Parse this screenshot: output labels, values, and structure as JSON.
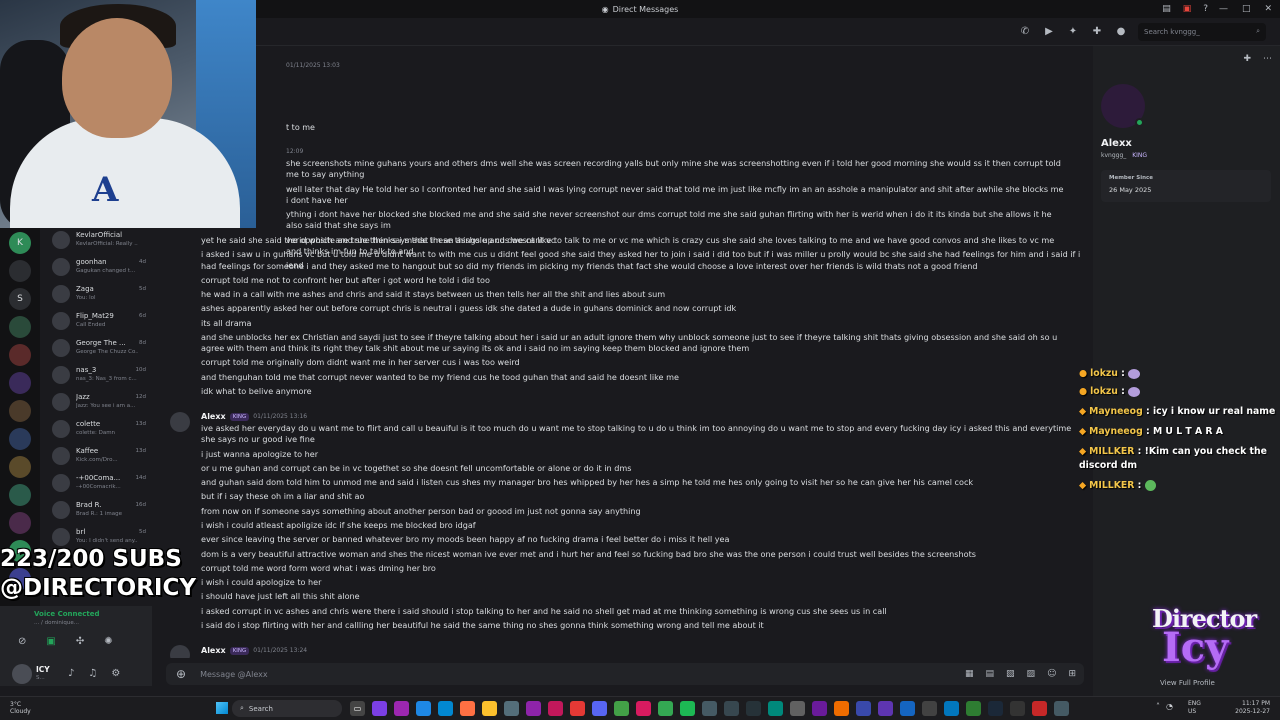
{
  "window": {
    "title": "Direct Messages"
  },
  "header": {
    "search_placeholder": "Search kvnggg_"
  },
  "dm_list": [
    {
      "name": "KevlarOfficial",
      "sub": "KevlarOfficial: Really ...",
      "time": ""
    },
    {
      "name": "goonhan",
      "sub": "Gagukan changed t...",
      "time": "4d"
    },
    {
      "name": "Zaga",
      "sub": "You: lol",
      "time": "5d"
    },
    {
      "name": "Flip_Mat29",
      "sub": "Call Ended",
      "time": "6d"
    },
    {
      "name": "George The ...",
      "sub": "George The Chuzz Co...",
      "time": "8d"
    },
    {
      "name": "nas_3",
      "sub": "nas_3: Nas_3 from c...",
      "time": "10d"
    },
    {
      "name": "Jazz",
      "sub": "Jazz: You see i am a...",
      "time": "12d"
    },
    {
      "name": "colette",
      "sub": "colette: Damn",
      "time": "13d"
    },
    {
      "name": "Kaffee",
      "sub": "Kick.com/Dro...",
      "time": "13d"
    },
    {
      "name": "-+00Coma...",
      "sub": "-+00Comacrik...",
      "time": "14d"
    },
    {
      "name": "Brad R.",
      "sub": "Brad R.: 1 image",
      "time": "16d"
    },
    {
      "name": "brl",
      "sub": "You: I didn't send any...",
      "time": "5d"
    }
  ],
  "messages": {
    "top_ts": "01/11/2025 13:03",
    "top_frag1": "t to me",
    "top_ts2": "12:09",
    "block1": [
      "she screenshots mine guhans yours and others dms well she was screen recording yalls but only mine she was screenshotting even if i told her good morning she would ss it then corrupt told me to say anything",
      "well later that day He told her so I confronted her and she said I was lying corrupt never said that told me im just like mcfly im an an asshole a manipulator and shit after awhile she blocks me i dont have her",
      "ything i dont have her blocked she blocked me and she said she never screenshot our dms corrupt told me she said guhan flirting with her is werid when i do it its kinda but she allows it he also said that she says im",
      "verid which are true then says that im an asshole and doesnt like to talk to me or vc me which is crazy cus she said she loves talking to me and we have good convos and she likes to vc me and thinks im fun to talk to and",
      "iend"
    ],
    "block2": [
      "yet he said she said the opposite and she thinks i made these things up cus we cant vc",
      "i asked i saw u in guhans vc but u told me u didnt want to with me cus u didnt feel good she said they asked her to join i said i did too but if i was miller u prolly would bc she said she had feelings for him and i said if i had feelings for someone i and they asked me to hangout but so did my friends im picking my friends that fact she would choose a love interest over her friends is wild thats not a good friend",
      "corrupt told me not to confront her but after i got word he told i did too",
      "he wad in a call with me ashes and chris and said it stays between us then tells her all the shit and lies about sum",
      "ashes apparently asked her out before corrupt chris is neutral i guess idk she dated a dude in guhans dominick and now corrupt idk",
      "its all drama",
      "and she unblocks her ex Christian and saydi just to see if theyre talking about her i said ur an adult ignore them why unblock someone just to see if theyre talking shit thats giving obsession and she said oh so u agree with them and think its right they talk shit about me ur saying its ok and i said no im saying keep them blocked and ignore them",
      "corrupt told me originally dom didnt want me in her server cus i was too weird",
      "and thenguhan told me that corrupt never wanted to be my friend cus he tood guhan that and said he doesnt like me",
      "idk what to belive anymore"
    ],
    "author1": "Alexx",
    "badge": "KING",
    "ts1": "01/11/2025 13:16",
    "block3": [
      "ive asked her everyday do u want me to flirt and call u beauiful is it too much do u want me to stop talking to u do u think im too annoying do u want me to stop and every fucking day icy i asked this and everytime she says no ur good ive fine",
      "i just wanna apologize to her",
      "or u me guhan and corrupt can be in vc togethet so she doesnt fell uncomfortable or alone or do it in dms",
      "and guhan said dom told him to unmod me and said i listen cus shes my manager bro hes whipped by her hes a simp he told me hes only going to visit her so he can give her his camel cock",
      "but if i say these oh im a liar and shit ao",
      "from now on if someone says something about another person bad or goood im just not gonna say anything",
      "i wish i could atleast apoligize idc if she keeps me blocked bro idgaf",
      "ever since leaving the server or banned whatever bro my moods been happy af no fucking drama i feel better do i miss it hell yea",
      "dom is a very beautiful attractive woman and shes the nicest woman ive ever met and i hurt her and feel so fucking bad bro she was the one person i could trust well besides the screenshots",
      "corrupt told me word form word what i was dming her bro",
      "i wish i could apologize to her",
      "i should have just left all this shit alone",
      "i asked corrupt in vc ashes and chris were there i said should i stop talking to her and he said no shell get mad at me thinking something is wrong cus she sees us in call",
      "i said do i stop flirting with her and callling her beautiful he said the same thing no shes gonna think something wrong and tell me about it"
    ],
    "author2": "Alexx",
    "ts2": "01/11/2025 13:24"
  },
  "composer": {
    "placeholder": "Message @Alexx"
  },
  "profile": {
    "name": "Alexx",
    "username": "kvnggg_",
    "badge": "KING",
    "member_since_label": "Member Since",
    "member_since": "26 May 2025",
    "view_full": "View Full Profile"
  },
  "stream_chat": [
    {
      "user": "lokzu",
      "msg": ""
    },
    {
      "user": "lokzu",
      "msg": ""
    },
    {
      "user": "Mayneeog",
      "msg": "icy i know ur real name"
    },
    {
      "user": "Mayneeog",
      "msg": "M U L T A R A"
    },
    {
      "user": "MILLKER",
      "msg": "!Kim can you check the discord dm"
    },
    {
      "user": "MILLKER",
      "msg": ""
    }
  ],
  "overlay": {
    "subs": "223/200 SUBS",
    "handle": "@DIRECTORICY",
    "logo_top": "Director",
    "logo_bottom": "Icy"
  },
  "voice": {
    "status": "Voice Connected",
    "sub": "... / dominique...",
    "user": "ICY",
    "user_sub": "S..."
  },
  "taskbar": {
    "temp": "3°C",
    "weather": "Cloudy",
    "search": "Search",
    "lang1": "ENG",
    "lang2": "US",
    "time": "11:17 PM",
    "date": "2025-12-27"
  }
}
